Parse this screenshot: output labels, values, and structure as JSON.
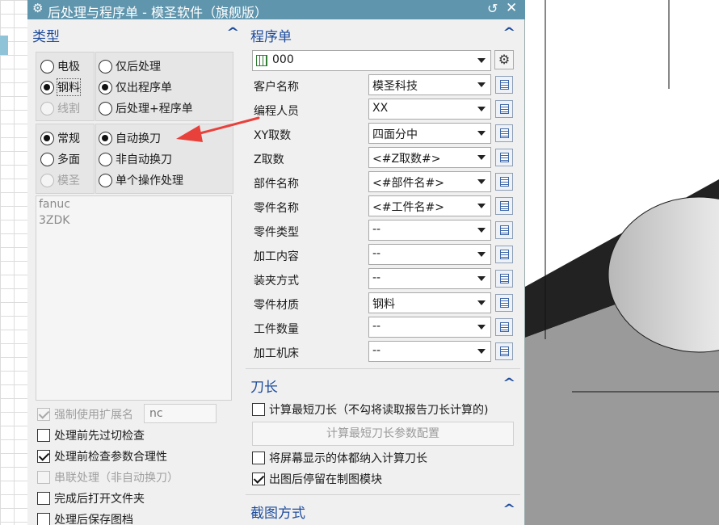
{
  "window": {
    "title": "后处理与程序单 - 模圣软件（旗舰版）"
  },
  "type_section": {
    "title": "类型",
    "group1_left": [
      {
        "label": "电极",
        "selected": false,
        "disabled": false
      },
      {
        "label": "钢料",
        "selected": true,
        "disabled": false
      },
      {
        "label": "线割",
        "selected": false,
        "disabled": true
      }
    ],
    "group1_right": [
      {
        "label": "仅后处理",
        "selected": false,
        "disabled": false
      },
      {
        "label": "仅出程序单",
        "selected": true,
        "disabled": false
      },
      {
        "label": "后处理+程序单",
        "selected": false,
        "disabled": false
      }
    ],
    "group2_left": [
      {
        "label": "常规",
        "selected": true,
        "disabled": false
      },
      {
        "label": "多面",
        "selected": false,
        "disabled": false
      },
      {
        "label": "模圣",
        "selected": false,
        "disabled": true
      }
    ],
    "group2_right": [
      {
        "label": "自动换刀",
        "selected": true,
        "disabled": false
      },
      {
        "label": "非自动换刀",
        "selected": false,
        "disabled": false
      },
      {
        "label": "单个操作处理",
        "selected": false,
        "disabled": false
      }
    ],
    "post_list": [
      "fanuc",
      "3ZDK"
    ],
    "force_ext": {
      "label": "强制使用扩展名",
      "checked": true,
      "disabled": true,
      "value": "nc"
    },
    "options": [
      {
        "label": "处理前先过切检查",
        "checked": false,
        "disabled": false
      },
      {
        "label": "处理前检查参数合理性",
        "checked": true,
        "disabled": false
      },
      {
        "label": "串联处理（非自动换刀）",
        "checked": false,
        "disabled": true
      },
      {
        "label": "完成后打开文件夹",
        "checked": false,
        "disabled": false
      },
      {
        "label": "处理后保存图档",
        "checked": false,
        "disabled": false
      }
    ]
  },
  "program_sheet": {
    "title": "程序单",
    "template": "000",
    "fields": [
      {
        "label": "客户名称",
        "value": "模圣科技"
      },
      {
        "label": "编程人员",
        "value": "XX"
      },
      {
        "label": "XY取数",
        "value": "四面分中"
      },
      {
        "label": "Z取数",
        "value": "<#Z取数#>"
      },
      {
        "label": "部件名称",
        "value": "<#部件名#>"
      },
      {
        "label": "零件名称",
        "value": "<#工件名#>"
      },
      {
        "label": "零件类型",
        "value": "--"
      },
      {
        "label": "加工内容",
        "value": "--"
      },
      {
        "label": "装夹方式",
        "value": "--"
      },
      {
        "label": "零件材质",
        "value": "钢料"
      },
      {
        "label": "工件数量",
        "value": "--"
      },
      {
        "label": "加工机床",
        "value": "--"
      }
    ]
  },
  "tool_length": {
    "title": "刀长",
    "calc_shortest": {
      "label": "计算最短刀长（不勾将读取报告刀长计算的)",
      "checked": false
    },
    "config_button": "计算最短刀长参数配置",
    "include_visible": {
      "label": "将屏幕显示的体都纳入计算刀长",
      "checked": false
    },
    "stay_drafting": {
      "label": "出图后停留在制图模块",
      "checked": true
    }
  },
  "screenshot_section": {
    "title": "截图方式"
  },
  "colors": {
    "titlebar": "#5f95ad",
    "section_title": "#1e4c9c",
    "annotation_arrow": "#e8413c"
  }
}
